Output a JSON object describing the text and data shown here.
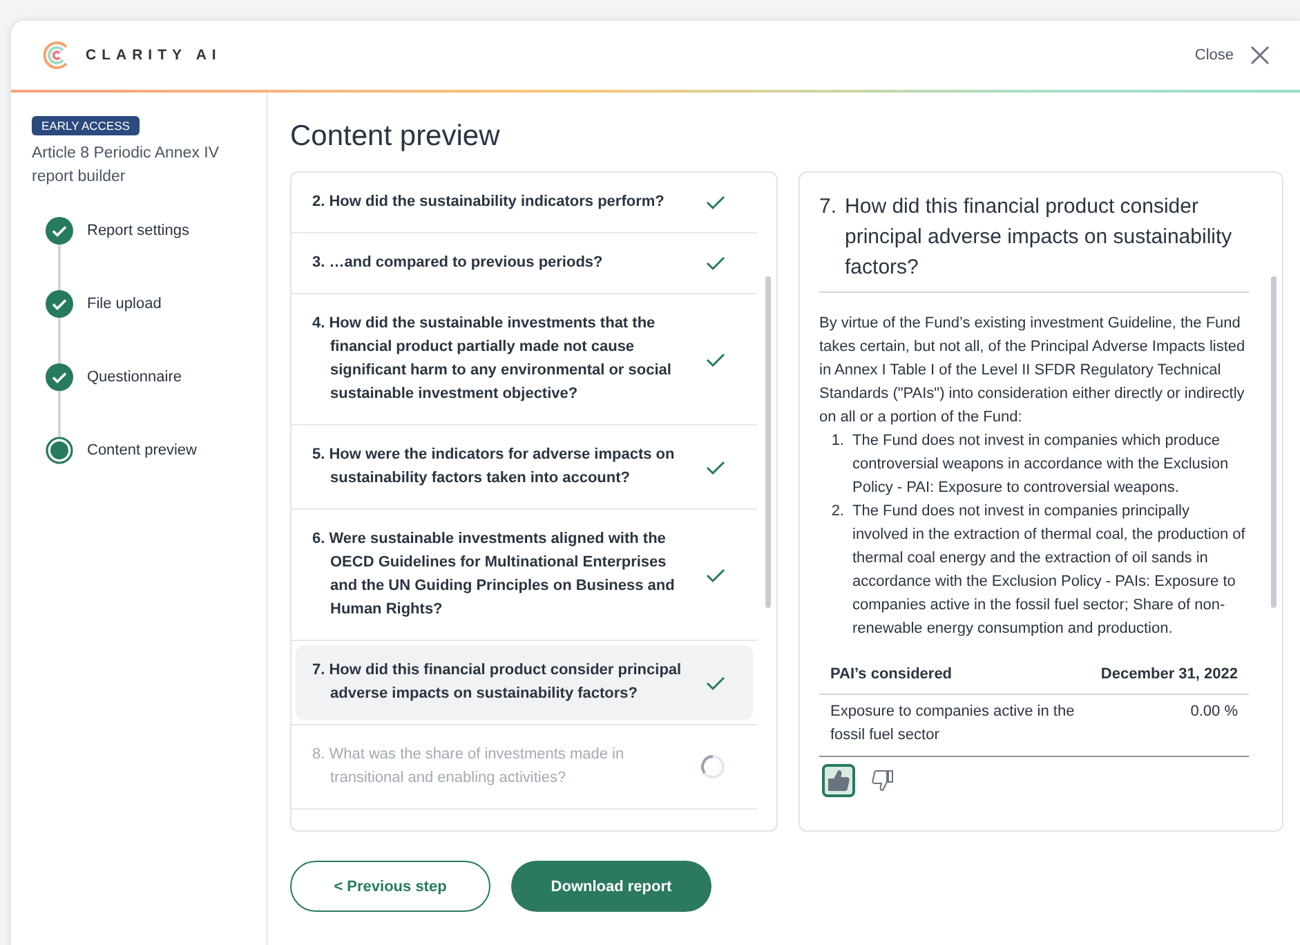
{
  "header": {
    "logo_text": "CLARITY AI",
    "close_label": "Close"
  },
  "sidebar": {
    "badge": "EARLY ACCESS",
    "title": "Article 8 Periodic Annex IV report builder",
    "steps": [
      {
        "label": "Report settings",
        "complete": true
      },
      {
        "label": "File upload",
        "complete": true
      },
      {
        "label": "Questionnaire",
        "complete": true
      },
      {
        "label": "Content preview",
        "complete": false
      }
    ]
  },
  "page_title": "Content preview",
  "questions": [
    {
      "text": "2. How did the sustainability indicators perform?",
      "complete": true,
      "selected": false
    },
    {
      "text": "3. …and compared to previous periods?",
      "complete": true,
      "selected": false
    },
    {
      "text": "4. How did the sustainable investments that the financial product partially made not cause significant harm to any environmental or social sustainable investment objective?",
      "complete": true,
      "selected": false
    },
    {
      "text": "5. How were the indicators for adverse impacts on sustainability factors taken into account?",
      "complete": true,
      "selected": false
    },
    {
      "text": "6. Were sustainable investments aligned with the OECD Guidelines for Multinational Enterprises and the UN Guiding Principles on Business and Human Rights?",
      "complete": true,
      "selected": false
    },
    {
      "text": "7. How did this financial product consider principal adverse impacts on sustainability factors?",
      "complete": true,
      "selected": true
    },
    {
      "text": "8. What was the share of investments made in transitional and enabling activities?",
      "complete": false,
      "selected": false
    }
  ],
  "preview": {
    "number": "7.",
    "heading": "How did this financial product consider principal adverse impacts on sustainability factors?",
    "intro": "By virtue of the Fund’s existing investment Guideline, the Fund takes certain, but not all, of the Principal Adverse Impacts listed in Annex I Table I of the Level II SFDR Regulatory Technical Standards (\"PAIs\") into consideration either directly or indirectly on all or a portion of the Fund:",
    "items": [
      {
        "number": "1.",
        "text": "The Fund does not invest in companies which produce controversial weapons in accordance with the Exclusion Policy - PAI: Exposure to controversial weapons."
      },
      {
        "number": "2.",
        "text": "The Fund does not invest in companies principally involved in the extraction of thermal coal, the production of thermal coal energy and the extraction of oil sands in accordance with the Exclusion Policy - PAIs: Exposure to companies active in the fossil fuel sector; Share of non-renewable energy consumption and production."
      }
    ],
    "table": {
      "columns": [
        "PAI’s considered",
        "December 31, 2022"
      ],
      "rows": [
        [
          "Exposure to companies active in the fossil fuel sector",
          "0.00 %"
        ]
      ]
    },
    "feedback": {
      "liked": true,
      "disliked": false
    }
  },
  "buttons": {
    "previous": "< Previous step",
    "download": "Download report"
  }
}
